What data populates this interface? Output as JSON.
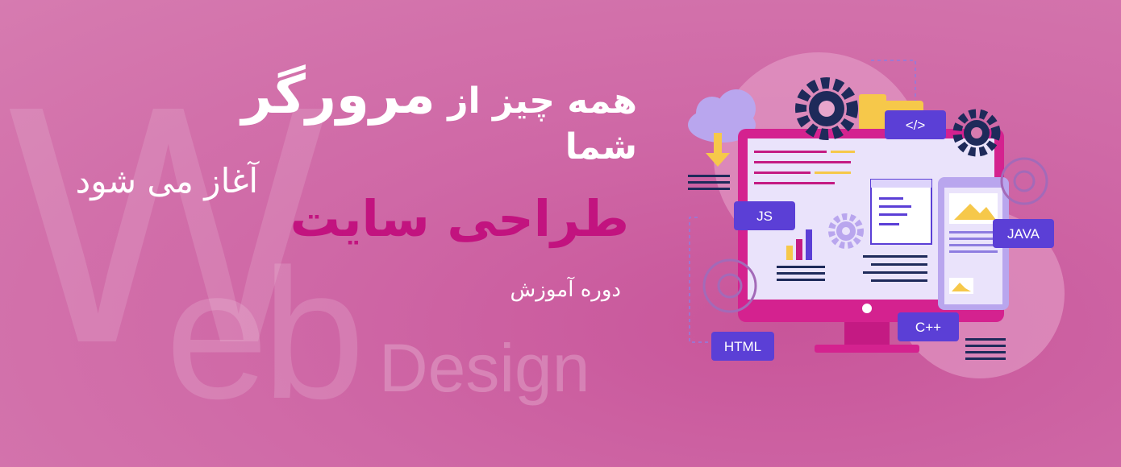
{
  "watermark": {
    "w": "W",
    "eb": "eb",
    "design": "Design"
  },
  "headline": {
    "part1": "همه چیز از ",
    "big": "مرورگر",
    "part2": " شما"
  },
  "subline": "آغاز می شود",
  "title": "طراحی سایت",
  "course": "دوره آموزش",
  "badges": {
    "js": "JS",
    "java": "JAVA",
    "html": "HTML",
    "cpp": "C++",
    "code": "</>"
  },
  "colors": {
    "background": "#d06aa8",
    "title": "#c2137f",
    "monitor": "#d4228f",
    "badge": "#5b3fd6",
    "gear": "#1e2a5a",
    "accent_yellow": "#f6c84a"
  }
}
